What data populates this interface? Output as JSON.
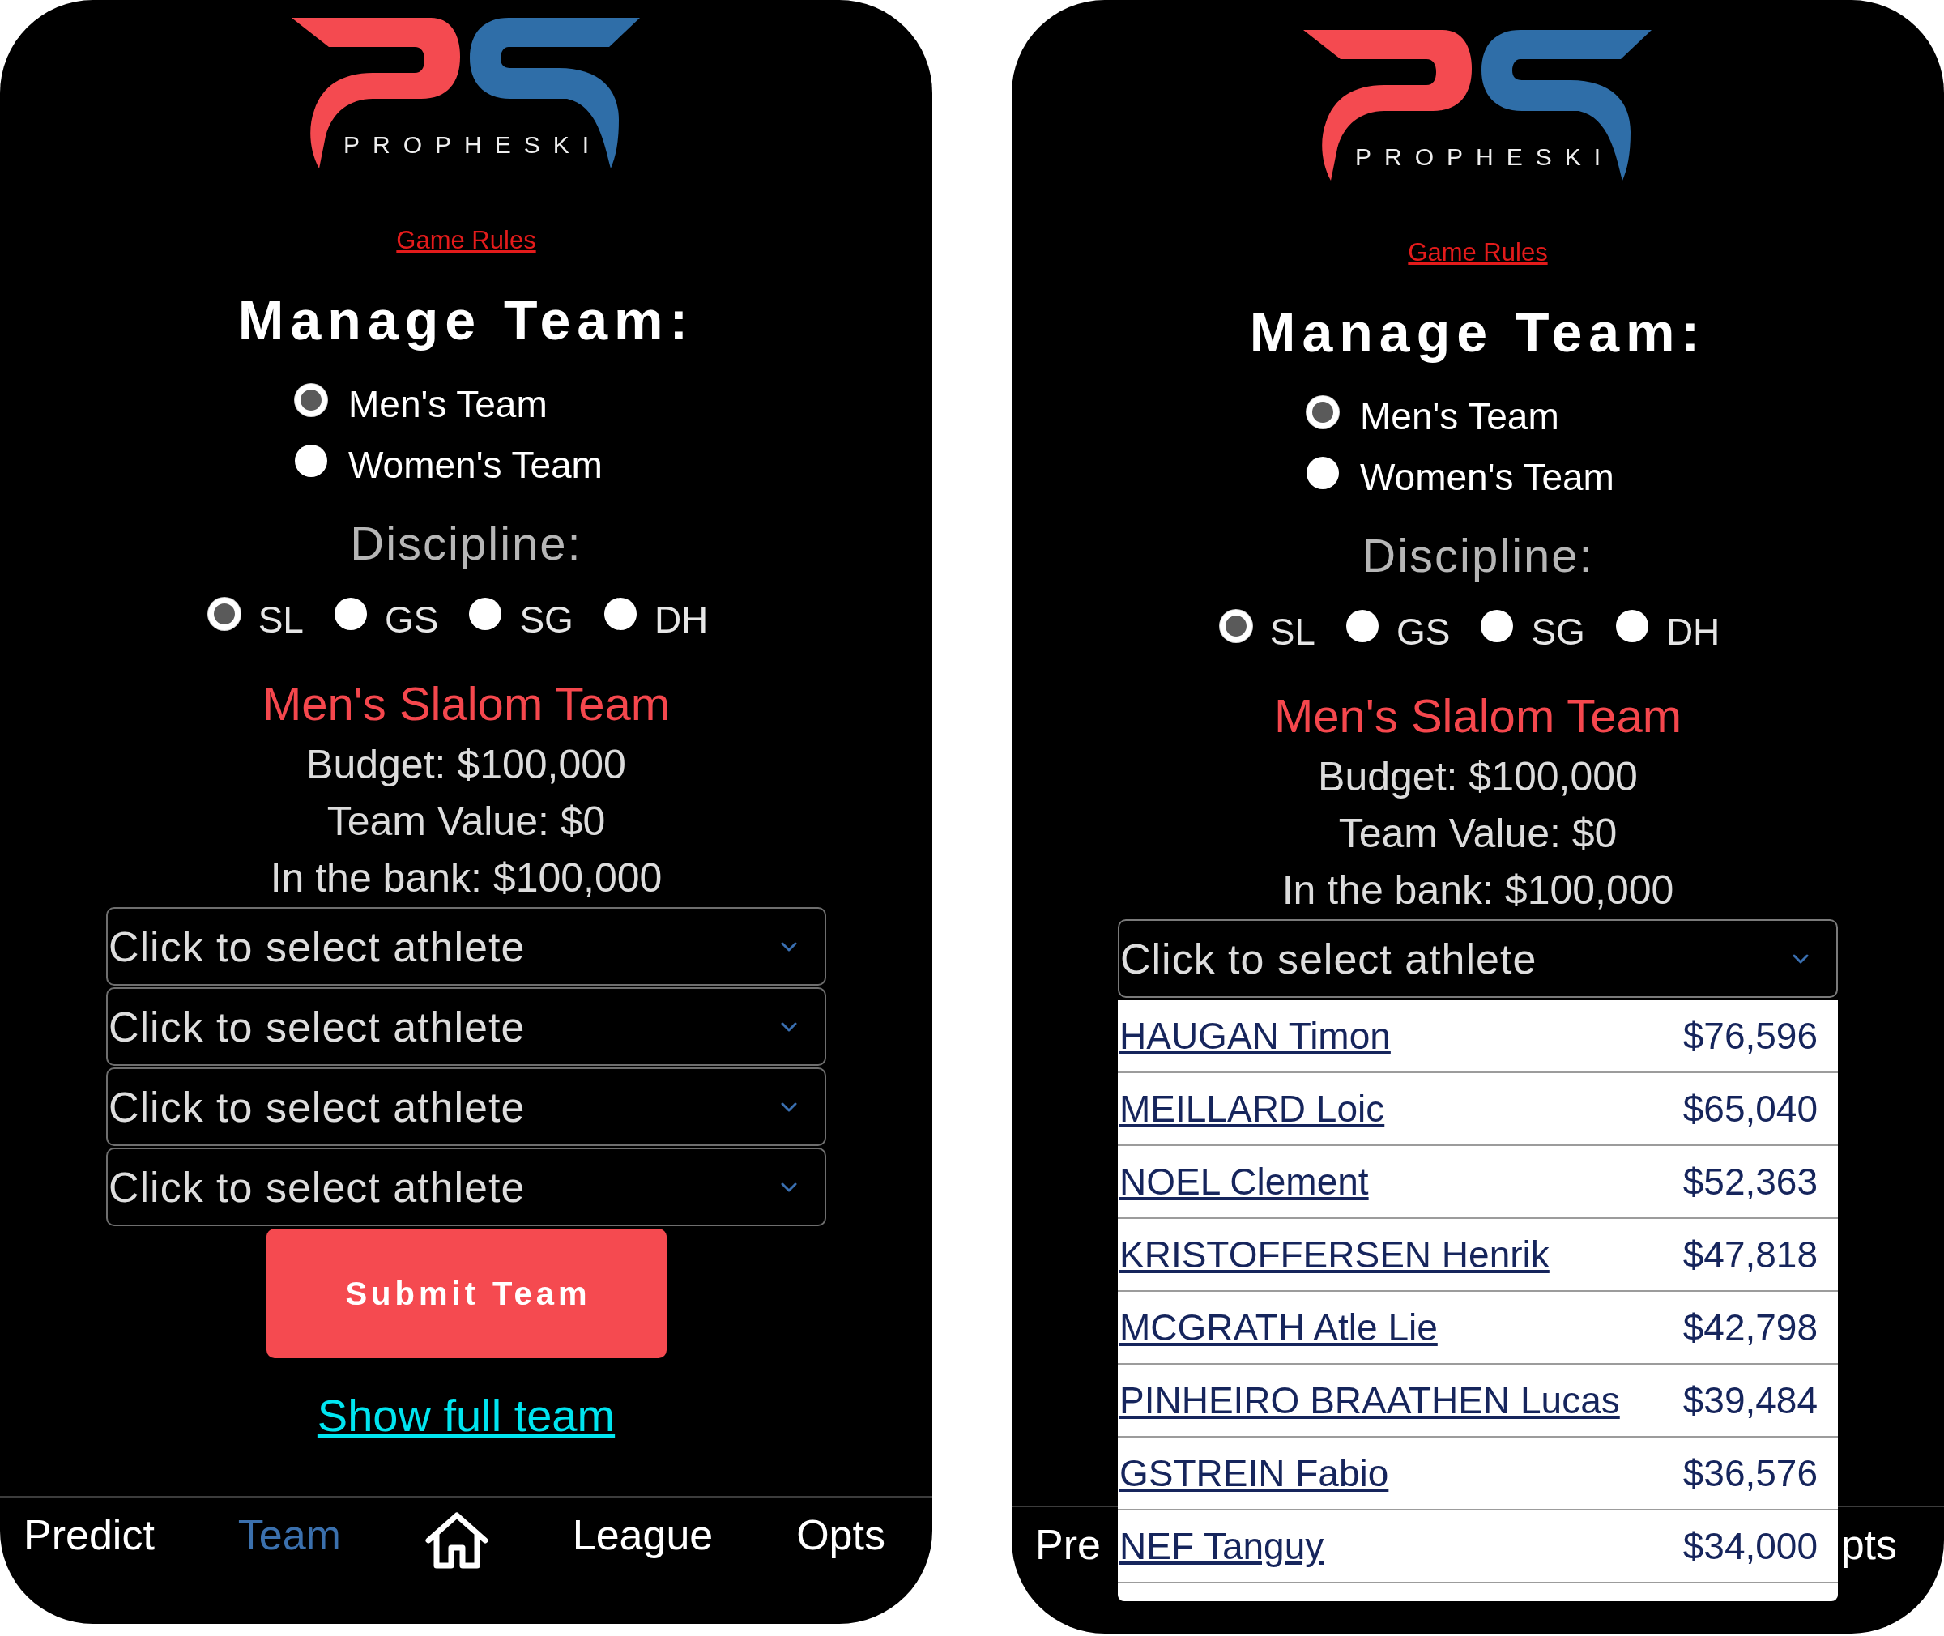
{
  "screens": [
    {
      "logo": {
        "wordmark": "PROPHESKI"
      },
      "game_rules_link": "Game Rules",
      "title": "Manage Team:",
      "team_options": [
        {
          "label": "Men's Team",
          "selected": true
        },
        {
          "label": "Women's Team",
          "selected": false
        }
      ],
      "discipline_label": "Discipline:",
      "disciplines": [
        {
          "label": "SL",
          "selected": true
        },
        {
          "label": "GS",
          "selected": false
        },
        {
          "label": "SG",
          "selected": false
        },
        {
          "label": "DH",
          "selected": false
        }
      ],
      "team_heading": "Men's Slalom Team",
      "stats": [
        "Budget: $100,000",
        "Team Value: $0",
        "In the bank: $100,000"
      ],
      "athlete_selects": [
        {
          "placeholder": "Click to select athlete",
          "expanded": false
        },
        {
          "placeholder": "Click to select athlete",
          "expanded": false
        },
        {
          "placeholder": "Click to select athlete",
          "expanded": false
        },
        {
          "placeholder": "Click to select athlete",
          "expanded": false
        }
      ],
      "submit_button": "Submit Team",
      "full_team_link": "Show full team",
      "nav": [
        {
          "kind": "text",
          "label": "Predict",
          "selected": false
        },
        {
          "kind": "text",
          "label": "Team",
          "selected": true
        },
        {
          "kind": "home",
          "selected": false
        },
        {
          "kind": "text",
          "label": "League",
          "selected": false
        },
        {
          "kind": "text",
          "label": "Opts",
          "selected": false
        }
      ]
    },
    {
      "logo": {
        "wordmark": "PROPHESKI"
      },
      "game_rules_link": "Game Rules",
      "title": "Manage Team:",
      "team_options": [
        {
          "label": "Men's Team",
          "selected": true
        },
        {
          "label": "Women's Team",
          "selected": false
        }
      ],
      "discipline_label": "Discipline:",
      "disciplines": [
        {
          "label": "SL",
          "selected": true
        },
        {
          "label": "GS",
          "selected": false
        },
        {
          "label": "SG",
          "selected": false
        },
        {
          "label": "DH",
          "selected": false
        }
      ],
      "team_heading": "Men's Slalom Team",
      "stats": [
        "Budget: $100,000",
        "Team Value: $0",
        "In the bank: $100,000"
      ],
      "athlete_selects": [
        {
          "placeholder": "Click to select athlete",
          "expanded": true,
          "options": [
            {
              "name": "HAUGAN Timon",
              "price": "$76,596"
            },
            {
              "name": "MEILLARD Loic",
              "price": "$65,040"
            },
            {
              "name": "NOEL Clement",
              "price": "$52,363"
            },
            {
              "name": "KRISTOFFERSEN Henrik",
              "price": "$47,818"
            },
            {
              "name": "MCGRATH Atle Lie",
              "price": "$42,798"
            },
            {
              "name": "PINHEIRO BRAATHEN Lucas",
              "price": "$39,484"
            },
            {
              "name": "GSTREIN Fabio",
              "price": "$36,576"
            },
            {
              "name": "NEF Tanguy",
              "price": "$34,000"
            }
          ]
        }
      ],
      "nav": [
        {
          "kind": "text",
          "label": "Pre",
          "selected": false
        },
        {
          "kind": "text",
          "label": "pts",
          "selected": false
        }
      ]
    }
  ]
}
